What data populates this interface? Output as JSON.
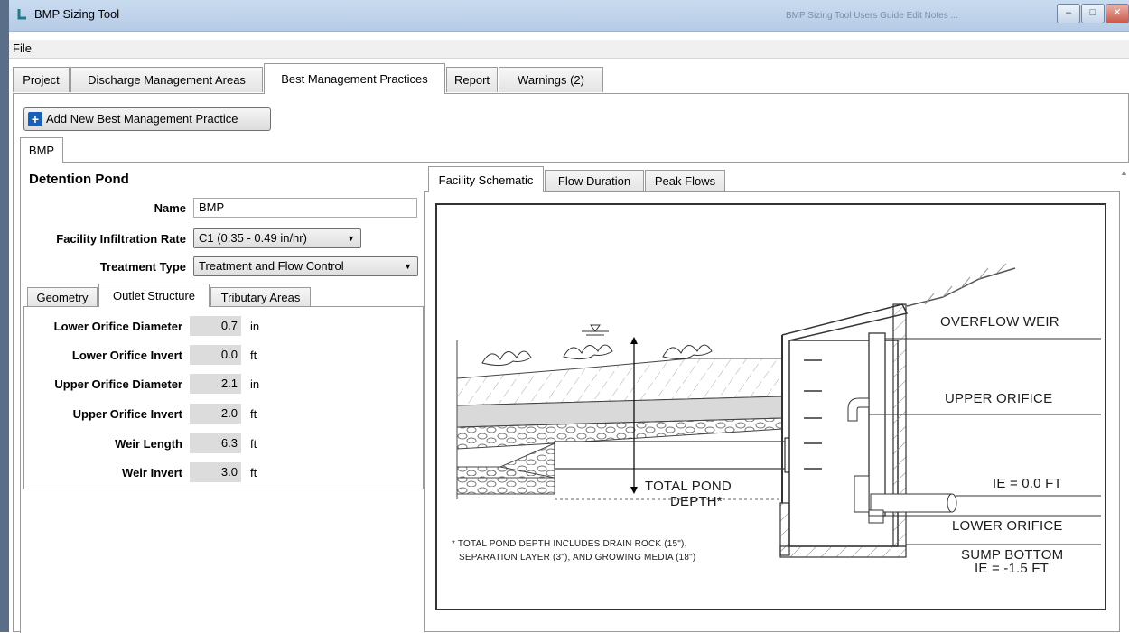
{
  "window": {
    "title": "BMP Sizing Tool",
    "title_right": "BMP Sizing Tool Users Guide Edit Notes ...",
    "minimize": "–",
    "maximize": "□",
    "close": "✕"
  },
  "menu": {
    "file": "File"
  },
  "main_tabs": [
    "Project",
    "Discharge Management Areas",
    "Best Management Practices",
    "Report",
    "Warnings (2)"
  ],
  "add_button": {
    "icon": "+",
    "label": "Add New Best Management Practice"
  },
  "bmp_tab": "BMP",
  "facility": {
    "title": "Detention Pond",
    "name_label": "Name",
    "name_value": "BMP",
    "infiltration_label": "Facility Infiltration Rate",
    "infiltration_value": "C1 (0.35 - 0.49 in/hr)",
    "treatment_label": "Treatment Type",
    "treatment_value": "Treatment and Flow Control"
  },
  "sub_tabs": [
    "Geometry",
    "Outlet Structure",
    "Tributary Areas"
  ],
  "outlet": [
    {
      "label": "Lower Orifice Diameter",
      "value": "0.7",
      "unit": "in"
    },
    {
      "label": "Lower Orifice Invert",
      "value": "0.0",
      "unit": "ft"
    },
    {
      "label": "Upper Orifice Diameter",
      "value": "2.1",
      "unit": "in"
    },
    {
      "label": "Upper Orifice Invert",
      "value": "2.0",
      "unit": "ft"
    },
    {
      "label": "Weir Length",
      "value": "6.3",
      "unit": "ft"
    },
    {
      "label": "Weir Invert",
      "value": "3.0",
      "unit": "ft"
    }
  ],
  "right_tabs": [
    "Facility Schematic",
    "Flow Duration",
    "Peak Flows"
  ],
  "schematic": {
    "overflow_weir": "OVERFLOW WEIR",
    "upper_orifice": "UPPER ORIFICE",
    "ie_zero": "IE = 0.0 FT",
    "lower_orifice": "LOWER ORIFICE",
    "sump_bottom": "SUMP BOTTOM",
    "sump_ie": "IE = -1.5 FT",
    "total_depth_1": "TOTAL POND",
    "total_depth_2": "DEPTH*",
    "note_1": "* TOTAL POND DEPTH INCLUDES DRAIN ROCK (15\"),",
    "note_2": "SEPARATION LAYER (3\"), AND GROWING MEDIA (18\")"
  },
  "colors": {
    "accent": "#1a5fb4",
    "titlebar": "#c9dbef",
    "readonly_field": "#dcdcdc"
  }
}
